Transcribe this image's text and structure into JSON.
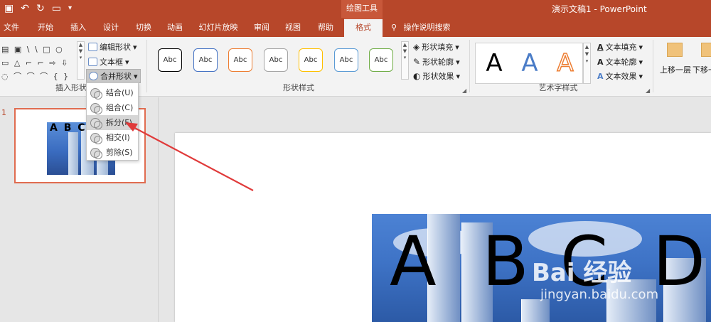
{
  "quick_access": {
    "save_icon": "save-icon",
    "undo_icon": "undo-icon",
    "redo_icon": "redo-icon",
    "present_icon": "present-from-start-icon",
    "customize_icon": "customize-qat-icon"
  },
  "context_tools_title": "绘图工具",
  "window_title": "演示文稿1  -  PowerPoint",
  "tabs": [
    "文件",
    "开始",
    "插入",
    "设计",
    "切换",
    "动画",
    "幻灯片放映",
    "审阅",
    "视图",
    "帮助",
    "格式"
  ],
  "active_tab": "格式",
  "tell_me": "操作说明搜索",
  "groups": {
    "insert_shapes": "插入形状",
    "shape_styles": "形状样式",
    "wordart_styles": "艺术字样式"
  },
  "insert_shapes": {
    "shape_rows": [
      "▤ ▣ \\ \\ □ ○",
      "▭ △ ⌐ ⌐ ⇨ ⇩",
      "◌ ⌒ ⌒ ⌒ { }"
    ],
    "edit_shape": "编辑形状",
    "text_box": "文本框",
    "merge_shapes": "合并形状"
  },
  "shape_styles": {
    "abc_label": "Abc",
    "colors": [
      "#000000",
      "#4472c4",
      "#ed7d31",
      "#a5a5a5",
      "#ffc000",
      "#5b9bd5",
      "#70ad47"
    ],
    "fill": "形状填充",
    "outline": "形状轮廓",
    "effects": "形状效果"
  },
  "wordart": {
    "letter": "A",
    "fill": "文本填充",
    "outline": "文本轮廓",
    "effects": "文本效果"
  },
  "arrange": {
    "bring_forward": "上移一层",
    "send_backward": "下移一"
  },
  "merge_menu": {
    "items": [
      "结合(U)",
      "组合(C)",
      "拆分(F)",
      "相交(I)",
      "剪除(S)"
    ],
    "highlighted": "拆分(F)"
  },
  "slides": {
    "number": "1",
    "thumb_letters": "A B C"
  },
  "slide_content": {
    "letters": [
      "A",
      "B",
      "C",
      "D"
    ]
  },
  "watermark": {
    "brand": "Bai 经验",
    "url": "jingyan.baidu.com"
  },
  "accent_color": "#b7472a",
  "annotation_color": "#e03a3a"
}
